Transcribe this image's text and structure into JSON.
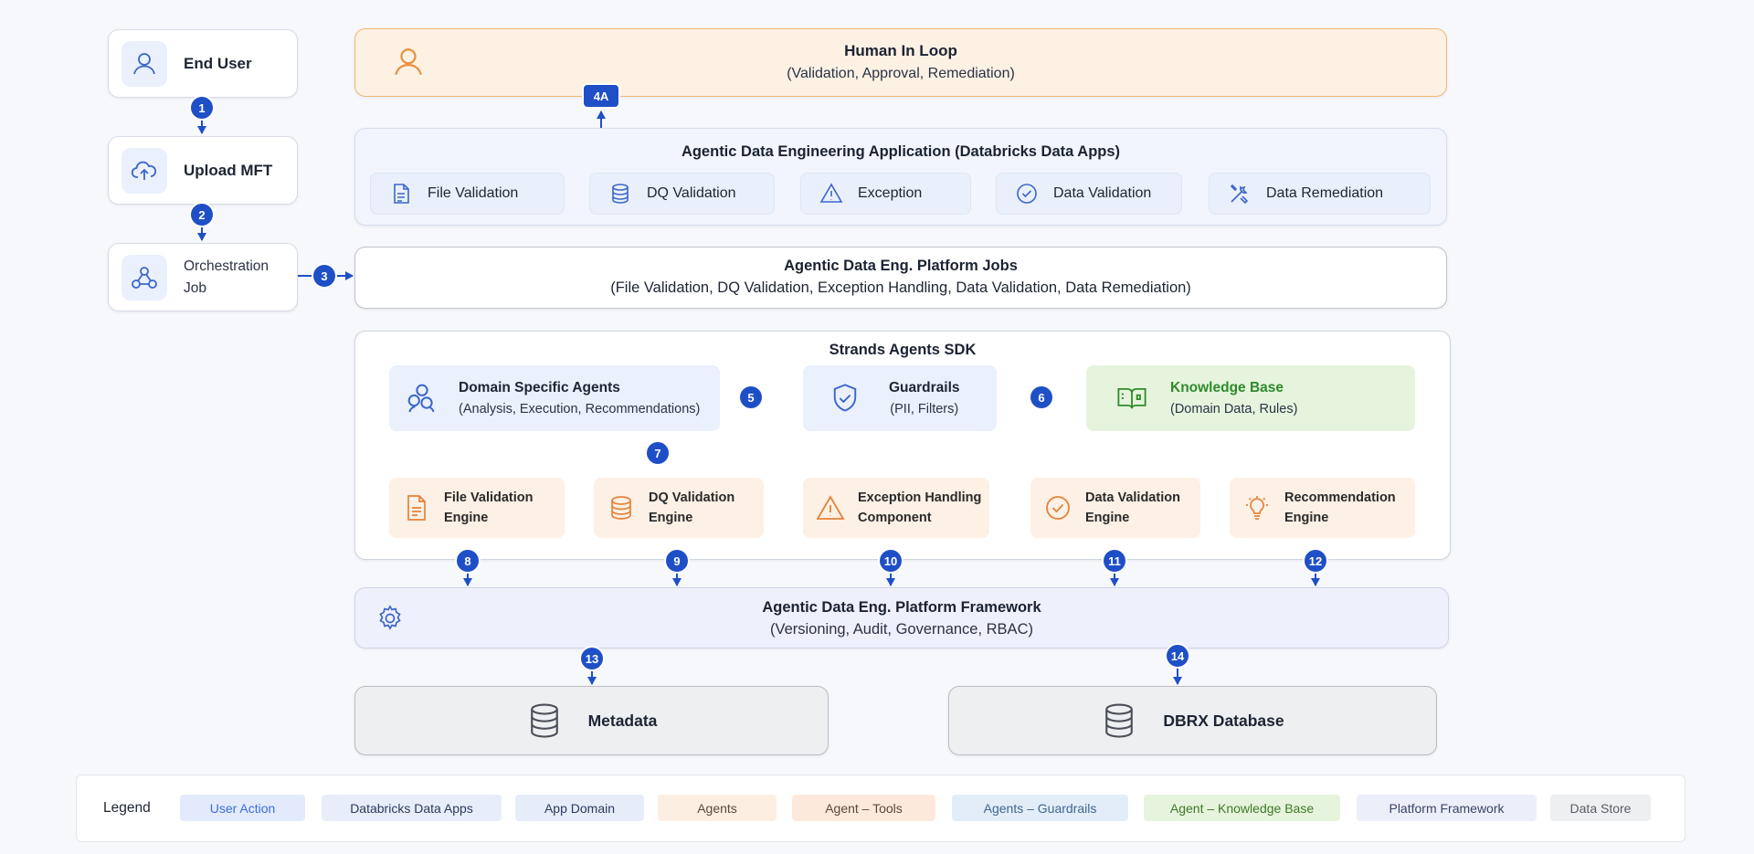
{
  "left_flow": {
    "end_user": "End User",
    "upload": "Upload MFT",
    "orchestration_line1": "Orchestration",
    "orchestration_line2": "Job"
  },
  "human_in_loop": {
    "title": "Human In Loop",
    "subtitle": "(Validation, Approval, Remediation)"
  },
  "app": {
    "title": "Agentic Data Engineering Application (Databricks Data Apps)",
    "modules": [
      "File Validation",
      "DQ Validation",
      "Exception",
      "Data Validation",
      "Data Remediation"
    ]
  },
  "jobs": {
    "title": "Agentic Data Eng. Platform Jobs",
    "subtitle": "(File Validation, DQ Validation, Exception Handling, Data Validation, Data Remediation)"
  },
  "sdk": {
    "title": "Strands Agents SDK",
    "domain_agents": {
      "title": "Domain Specific Agents",
      "subtitle": "(Analysis, Execution, Recommendations)"
    },
    "guardrails": {
      "title": "Guardrails",
      "subtitle": "(PII, Filters)"
    },
    "knowledge_base": {
      "title": "Knowledge Base",
      "subtitle": "(Domain Data, Rules)"
    },
    "engines": [
      {
        "line1": "File Validation",
        "line2": "Engine"
      },
      {
        "line1": "DQ Validation",
        "line2": "Engine"
      },
      {
        "line1": "Exception Handling",
        "line2": "Component"
      },
      {
        "line1": "Data Validation",
        "line2": "Engine"
      },
      {
        "line1": "Recommendation",
        "line2": "Engine"
      }
    ]
  },
  "framework": {
    "title": "Agentic Data Eng. Platform Framework",
    "subtitle": "(Versioning, Audit, Governance, RBAC)"
  },
  "stores": {
    "metadata": "Metadata",
    "dbrx": "DBRX Database"
  },
  "steps": [
    "1",
    "2",
    "3",
    "4A",
    "5",
    "6",
    "7",
    "8",
    "9",
    "10",
    "11",
    "12",
    "13",
    "14"
  ],
  "legend": {
    "label": "Legend",
    "items": [
      {
        "label": "User Action",
        "bg": "#e3eafc",
        "fg": "#3b6fd6"
      },
      {
        "label": "Databricks Data Apps",
        "bg": "#e8eef9",
        "fg": "#2b3a5c"
      },
      {
        "label": "App Domain",
        "bg": "#e6ecf8",
        "fg": "#2b3a5c"
      },
      {
        "label": "Agents",
        "bg": "#fcefe2",
        "fg": "#5a4a3a"
      },
      {
        "label": "Agent – Tools",
        "bg": "#fde9dc",
        "fg": "#5a4a3a"
      },
      {
        "label": "Agents – Guardrails",
        "bg": "#e3edf7",
        "fg": "#3d6690"
      },
      {
        "label": "Agent – Knowledge Base",
        "bg": "#e6f3dd",
        "fg": "#3f7a28"
      },
      {
        "label": "Platform Framework",
        "bg": "#eceef9",
        "fg": "#3c4465"
      },
      {
        "label": "Data Store",
        "bg": "#eeeff1",
        "fg": "#5a5e66"
      }
    ]
  },
  "colors": {
    "accent_blue": "#1f4fc7",
    "icon_blue": "#3b66c9",
    "human_orange": "#e9913f",
    "engine_orange": "#e5823a",
    "kb_green": "#2f8a2c"
  }
}
